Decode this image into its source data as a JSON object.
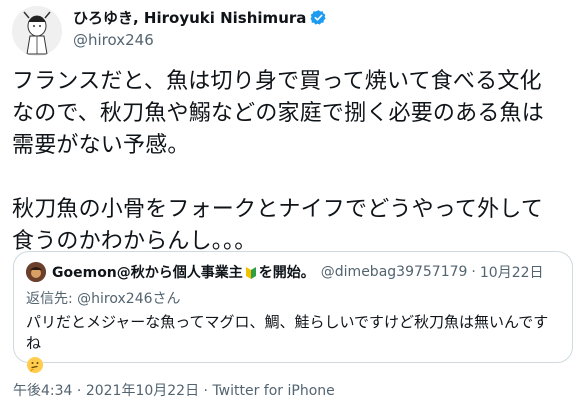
{
  "author": {
    "display_name": "ひろゆき, Hiroyuki Nishimura",
    "handle": "@hirox246",
    "verified": true,
    "verified_icon": "verified-badge-icon"
  },
  "tweet": {
    "text": "フランスだと、魚は切り身で買って焼いて食べる文化\nなので、秋刀魚や鰯などの家庭で捌く必要のある魚は\n需要がない予感。\n\n秋刀魚の小骨をフォークとナイフでどうやって外して\n食うのかわからんし。。。"
  },
  "quote": {
    "name_prefix": "Goemon@秋から個人事業主",
    "name_suffix": "を開始。",
    "name_icon": "beginner-mark-icon",
    "handle": "@dimebag39757179",
    "separator": "·",
    "date": "10月22日",
    "reply_label": "返信先:",
    "reply_to": "@hirox246さん",
    "text": "パリだとメジャーな魚ってマグロ、鯛、鮭らしいですけど秋刀魚は無いんですね",
    "emoji": "thinking-face-icon"
  },
  "meta": {
    "time": "午後4:34",
    "separator1": "·",
    "date": "2021年10月22日",
    "separator2": "·",
    "source": "Twitter for iPhone"
  },
  "colors": {
    "text": "#0f1419",
    "secondary": "#536471",
    "verified": "#1d9bf0",
    "border": "#cfd9de"
  }
}
